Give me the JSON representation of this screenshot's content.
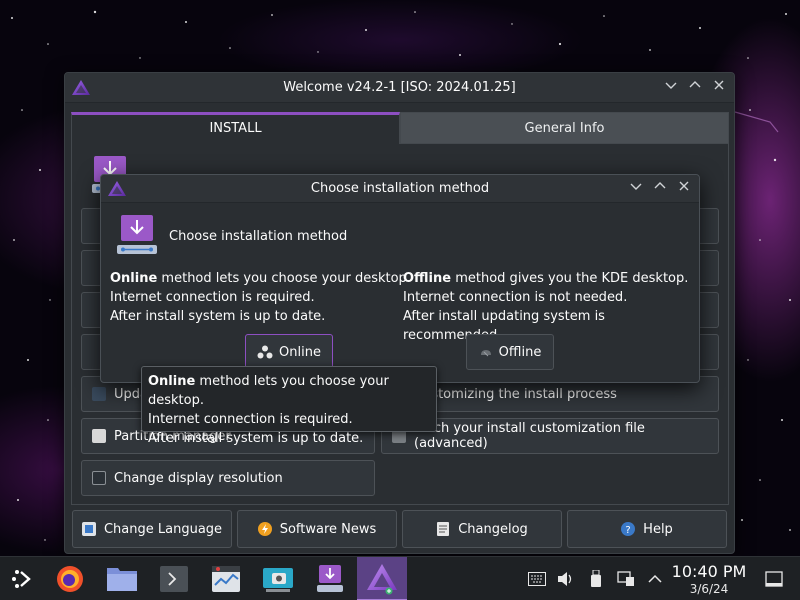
{
  "main_window": {
    "title": "Welcome v24.2-1 [ISO: 2024.01.25]",
    "tabs": [
      {
        "label": "INSTALL",
        "active": true
      },
      {
        "label": "General Info",
        "active": false
      }
    ],
    "buttons": [
      {
        "label": "Update Mirrors"
      },
      {
        "label": "Customizing the install process"
      },
      {
        "label": "Partition manager"
      },
      {
        "label": "Fetch your install customization file (advanced)"
      },
      {
        "label": "Change display resolution"
      }
    ],
    "footer": [
      {
        "label": "Change Language",
        "icon": "language-icon"
      },
      {
        "label": "Software News",
        "icon": "lightning-icon"
      },
      {
        "label": "Changelog",
        "icon": "document-icon"
      },
      {
        "label": "Help",
        "icon": "help-icon"
      }
    ]
  },
  "dialog": {
    "title": "Choose installation method",
    "heading": "Choose installation method",
    "online_desc": {
      "bold": "Online",
      "line1_rest": " method lets you choose your desktop.",
      "line2": "Internet connection is required.",
      "line3": "After install system is up to date."
    },
    "offline_desc": {
      "bold": "Offline",
      "line1_rest": " method gives you the KDE desktop.",
      "line2": "Internet connection is not needed.",
      "line3": "After install updating system is recommended."
    },
    "online_button": "Online",
    "offline_button": "Offline"
  },
  "tooltip": {
    "bold": "Online",
    "line1_rest": " method lets you choose your desktop.",
    "line2": "Internet connection is required.",
    "line3": "After install system is up to date."
  },
  "taskbar": {
    "apps": [
      "application-launcher-icon",
      "firefox-icon",
      "file-manager-icon",
      "terminal-icon",
      "system-monitor-icon",
      "screenshot-icon",
      "installer-icon",
      "welcome-icon"
    ],
    "clock_time": "10:40 PM",
    "clock_date": "3/6/24"
  },
  "colors": {
    "accent": "#8d4fc2",
    "window_bg": "#2a2e32",
    "button_bg": "#31363b",
    "taskbar_bg": "#1e2124"
  }
}
